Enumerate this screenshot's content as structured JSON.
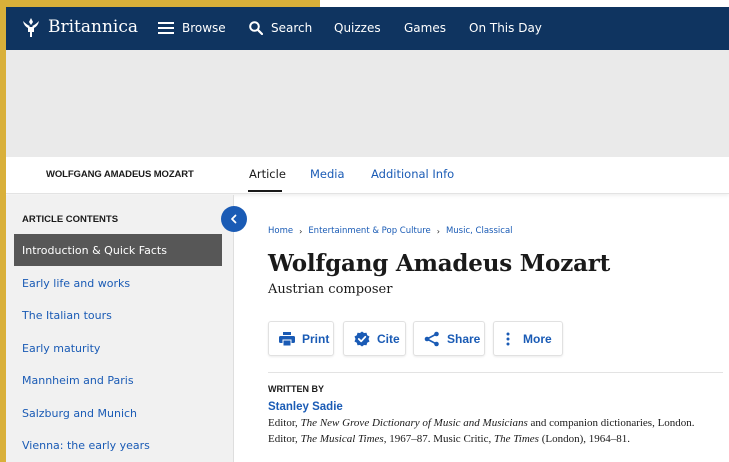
{
  "nav": {
    "brand": "Britannica",
    "items": [
      {
        "label": "Browse",
        "icon": "hamburger-icon"
      },
      {
        "label": "Search",
        "icon": "search-icon"
      },
      {
        "label": "Quizzes"
      },
      {
        "label": "Games"
      },
      {
        "label": "On This Day"
      }
    ]
  },
  "article_bar": {
    "title": "WOLFGANG AMADEUS MOZART",
    "tabs": [
      "Article",
      "Media",
      "Additional Info"
    ],
    "active_tab": "Article"
  },
  "sidebar": {
    "heading": "ARTICLE CONTENTS",
    "items": [
      "Introduction & Quick Facts",
      "Early life and works",
      "The Italian tours",
      "Early maturity",
      "Mannheim and Paris",
      "Salzburg and Munich",
      "Vienna: the early years"
    ],
    "active_index": 0
  },
  "breadcrumb": [
    "Home",
    "Entertainment & Pop Culture",
    "Music, Classical"
  ],
  "article": {
    "title": "Wolfgang Amadeus Mozart",
    "subtitle": "Austrian composer"
  },
  "actions": {
    "print": "Print",
    "cite": "Cite",
    "share": "Share",
    "more": "More"
  },
  "byline": {
    "label": "WRITTEN BY",
    "author": "Stanley Sadie",
    "bio": {
      "p1": "Editor, ",
      "work1": "The New Grove Dictionary of Music and Musicians",
      "p2": " and companion dictionaries, London. Editor, ",
      "work2": "The Musical Times",
      "p3": ", 1967–87. Music Critic, ",
      "work3": "The Times",
      "p4": " (London), 1964–81."
    }
  },
  "colors": {
    "nav_bg": "#0f3460",
    "link": "#1a5bb5",
    "toc_active_bg": "#575757",
    "ad_bg": "#eaeaea"
  }
}
